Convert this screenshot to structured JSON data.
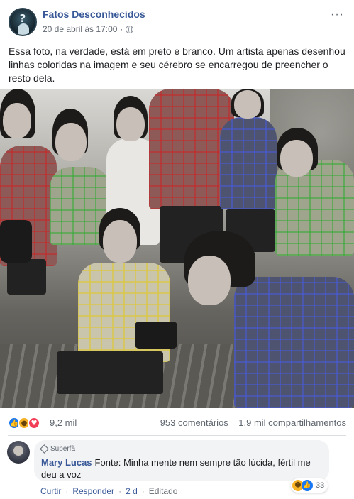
{
  "post": {
    "page_name": "Fatos Desconhecidos",
    "timestamp": "20 de abril às 17:00",
    "separator": "·",
    "audience_icon": "globe-icon",
    "more_icon": "···",
    "text": "Essa foto, na verdade, está em preto e branco. Um artista apenas desenhou linhas coloridas na imagem e seu cérebro se encarregou de preencher o resto dela."
  },
  "reactions": {
    "icons": [
      "like-icon",
      "wow-icon",
      "love-icon"
    ],
    "count": "9,2 mil",
    "comments": "953 comentários",
    "shares": "1,9 mil compartilhamentos"
  },
  "comment": {
    "badge": "Superfã",
    "author": "Mary Lucas",
    "text": "Fonte: Minha mente nem sempre tão lúcida, fértil me deu a voz",
    "actions": {
      "curtir": "Curtir",
      "responder": "Responder",
      "time": "2 d",
      "edited": "Editado",
      "dot": "·"
    },
    "reactions": {
      "icons": [
        "haha-icon",
        "like-icon"
      ],
      "count": "33"
    }
  },
  "colors": {
    "link_blue": "#385898",
    "text_gray": "#606770",
    "like_blue": "#1877f2",
    "love_red": "#f33e58",
    "wow_yellow": "#f7b125"
  }
}
